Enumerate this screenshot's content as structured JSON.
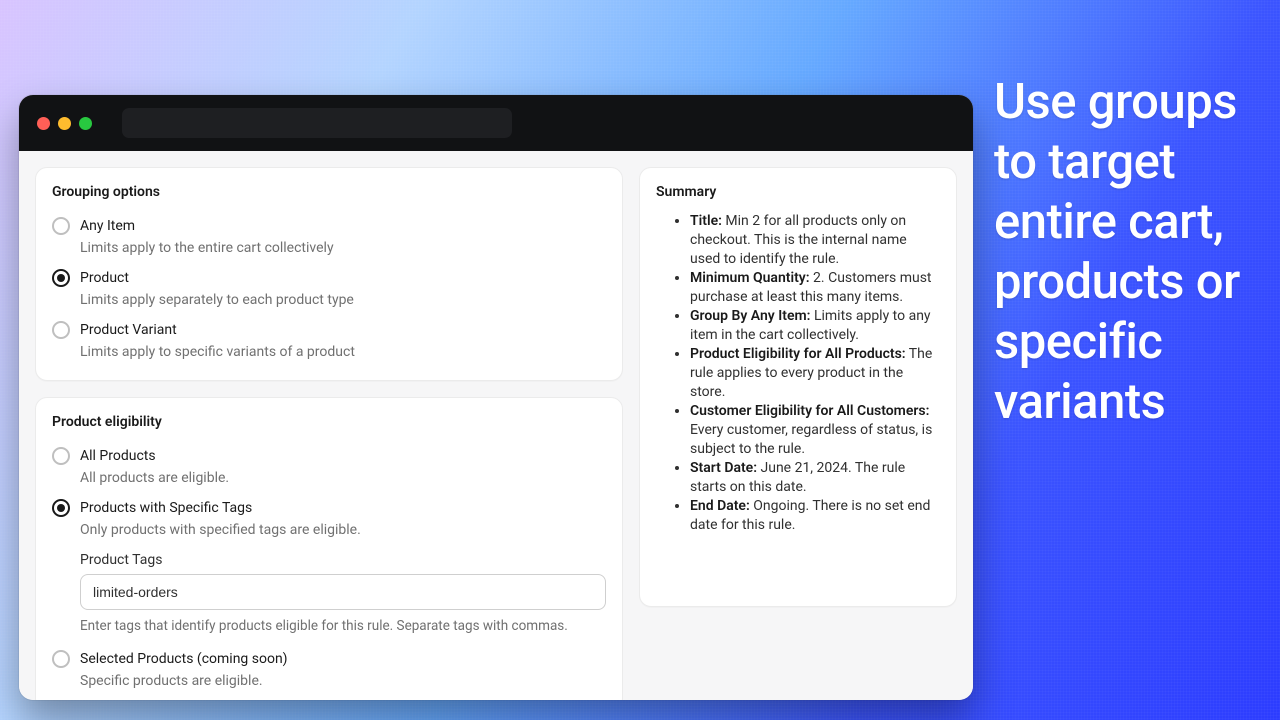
{
  "hero": "Use groups to target entire cart, products or specific variants",
  "grouping": {
    "title": "Grouping options",
    "options": [
      {
        "label": "Any Item",
        "desc": "Limits apply to the entire cart collectively"
      },
      {
        "label": "Product",
        "desc": "Limits apply separately to each product type"
      },
      {
        "label": "Product Variant",
        "desc": "Limits apply to specific variants of a product"
      }
    ],
    "selected": 1
  },
  "eligibility": {
    "title": "Product eligibility",
    "options": [
      {
        "label": "All Products",
        "desc": "All products are eligible."
      },
      {
        "label": "Products with Specific Tags",
        "desc": "Only products with specified tags are eligible."
      },
      {
        "label": "Selected Products (coming soon)",
        "desc": "Specific products are eligible."
      }
    ],
    "selected": 1,
    "tags_label": "Product Tags",
    "tags_value": "limited-orders",
    "tags_help": "Enter tags that identify products eligible for this rule. Separate tags with commas."
  },
  "summary": {
    "title": "Summary",
    "items": [
      {
        "k": "Title:",
        "v": " Min 2 for all products only on checkout. This is the internal name used to identify the rule."
      },
      {
        "k": "Minimum Quantity:",
        "v": " 2. Customers must purchase at least this many items."
      },
      {
        "k": "Group By Any Item:",
        "v": " Limits apply to any item in the cart collectively."
      },
      {
        "k": "Product Eligibility for All Products:",
        "v": " The rule applies to every product in the store."
      },
      {
        "k": "Customer Eligibility for All Customers:",
        "v": " Every customer, regardless of status, is subject to the rule."
      },
      {
        "k": "Start Date:",
        "v": " June 21, 2024. The rule starts on this date."
      },
      {
        "k": "End Date:",
        "v": " Ongoing. There is no set end date for this rule."
      }
    ]
  }
}
